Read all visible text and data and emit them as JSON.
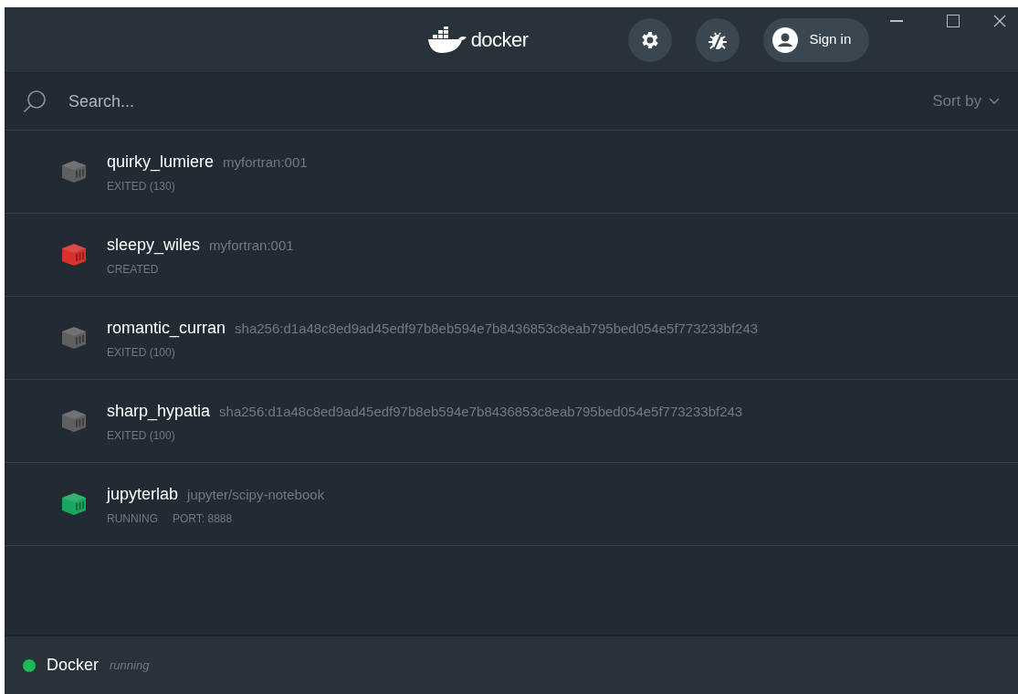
{
  "titlebar": {
    "logo": "docker",
    "sign_in": "Sign in"
  },
  "search": {
    "placeholder": "Search...",
    "sort": "Sort by"
  },
  "containers": [
    {
      "name": "quirky_lumiere",
      "image": "myfortran:001",
      "status": [
        "EXITED (130)"
      ],
      "color": "#5f5f5f"
    },
    {
      "name": "sleepy_wiles",
      "image": "myfortran:001",
      "status": [
        "CREATED"
      ],
      "color": "#d9302c"
    },
    {
      "name": "romantic_curran",
      "image": "sha256:d1a48c8ed9ad45edf97b8eb594e7b8436853c8eab795bed054e5f773233bf243",
      "status": [
        "EXITED (100)"
      ],
      "color": "#5f5f5f"
    },
    {
      "name": "sharp_hypatia",
      "image": "sha256:d1a48c8ed9ad45edf97b8eb594e7b8436853c8eab795bed054e5f773233bf243",
      "status": [
        "EXITED (100)"
      ],
      "color": "#5f5f5f"
    },
    {
      "name": "jupyterlab",
      "image": "jupyter/scipy-notebook",
      "status": [
        "RUNNING",
        "PORT: 8888"
      ],
      "color": "#1aa660"
    }
  ],
  "footer": {
    "name": "Docker",
    "state": "running",
    "color": "#1db954"
  }
}
